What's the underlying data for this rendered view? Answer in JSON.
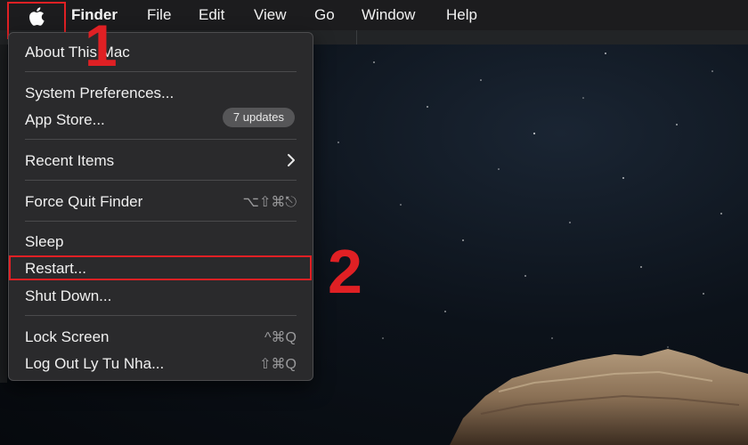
{
  "menubar": {
    "apple_icon": "apple-logo-icon",
    "items": [
      "Finder",
      "File",
      "Edit",
      "View",
      "Go",
      "Window",
      "Help"
    ]
  },
  "apple_menu": {
    "about": "About This Mac",
    "system_preferences": "System Preferences...",
    "app_store": "App Store...",
    "app_store_badge": "7 updates",
    "recent_items": "Recent Items",
    "force_quit": "Force Quit Finder",
    "force_quit_shortcut": "⌥⇧⌘⎋",
    "sleep": "Sleep",
    "restart": "Restart...",
    "shut_down": "Shut Down...",
    "lock_screen": "Lock Screen",
    "lock_screen_shortcut": "^⌘Q",
    "log_out": "Log Out Ly Tu Nha...",
    "log_out_shortcut": "⇧⌘Q"
  },
  "annotations": {
    "step1": "1",
    "step2": "2",
    "highlight_color": "#e02024"
  }
}
